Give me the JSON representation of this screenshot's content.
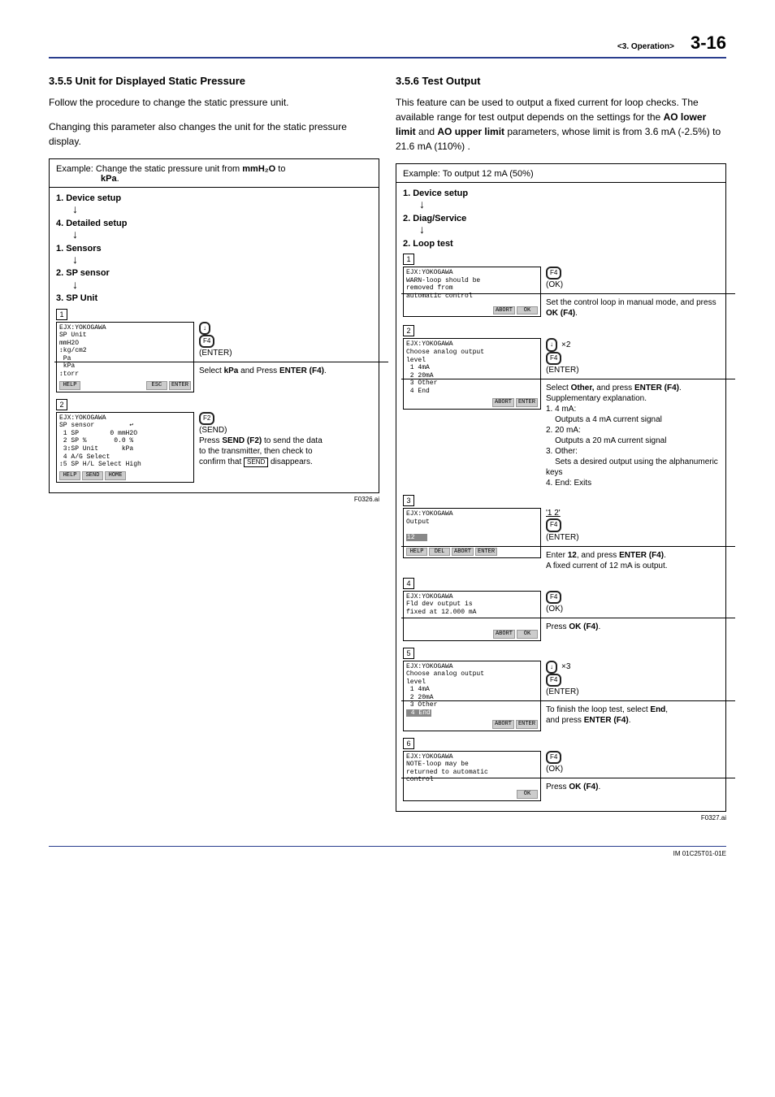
{
  "header": {
    "chapter": "<3. Operation>",
    "page": "3-16"
  },
  "left": {
    "heading": "3.5.5   Unit for Displayed Static Pressure",
    "para1": "Follow the procedure to change the static pressure unit.",
    "para2": "Changing this parameter also changes the unit for the static pressure display.",
    "example_prefix": "Example:  Change the static pressure unit from ",
    "example_strong1": "mmH₂O",
    "example_mid": " to ",
    "example_strong2": "kPa",
    "example_suffix": ".",
    "menu": [
      "1. Device setup",
      "4. Detailed setup",
      "1. Sensors",
      "2. SP sensor",
      "3. SP Unit"
    ],
    "step1_key1": "↓",
    "step1_key2": "F4",
    "step1_enter": "(ENTER)",
    "step1_text_a": "Select ",
    "step1_text_b": "kPa",
    "step1_text_c": " and Press ",
    "step1_text_d": "ENTER (F4)",
    "step1_text_e": ".",
    "step2_key1": "F2",
    "step2_send": "(SEND)",
    "step2_line1_a": "Press ",
    "step2_line1_b": "SEND (F2)",
    "step2_line1_c": " to send the data",
    "step2_line2": "to the transmitter, then check to",
    "step2_line3_a": "confirm that ",
    "step2_line3_tag": "SEND",
    "step2_line3_b": " disappears.",
    "lcd1": {
      "title": "EJX:YOKOGAWA",
      "lines": "SP Unit\nmmH2O\n↕kg/cm2\n Pa\n kPa\n↕torr",
      "sk1": "HELP",
      "sk2": "ESC",
      "sk3": "ENTER"
    },
    "lcd2": {
      "title": "EJX:YOKOGAWA",
      "lines": "SP sensor         ↩\n 1 SP        0 mmH2O\n 2 SP %       0.0 %\n 3↕SP Unit      kPa\n 4 A/G Select\n↕5 SP H/L Select High",
      "sk1": "HELP",
      "sk2": "SEND",
      "sk3": "HOME"
    },
    "figref": "F0326.ai"
  },
  "right": {
    "heading": "3.5.6   Test Output",
    "para_a": "This feature can be used to output a fixed current for loop checks. The available range for test output depends on the settings for the ",
    "para_b": "AO lower limit",
    "para_c": " and ",
    "para_d": "AO upper limit",
    "para_e": " parameters, whose limit is from 3.6 mA (-2.5%) to 21.6 mA (110%) .",
    "example": "Example:  To output 12 mA (50%)",
    "menu": [
      "1. Device setup",
      "2. Diag/Service",
      "2. Loop test"
    ],
    "s1_key": "F4",
    "s1_ok": "(OK)",
    "s1_text_a": "Set the control loop in manual mode, and press ",
    "s1_text_b": "OK (F4)",
    "s1_text_c": ".",
    "lcd1": {
      "title": "EJX:YOKOGAWA",
      "lines": "WARN-loop should be\nremoved from\nautomatic control",
      "sk1": "ABORT",
      "sk2": "OK"
    },
    "s2_arrow": "↓",
    "s2_x2": "×2",
    "s2_f4": "F4",
    "s2_enter": "(ENTER)",
    "s2_line1_a": "Select ",
    "s2_line1_b": "Other,",
    "s2_line1_c": " and press ",
    "s2_line1_d": "ENTER (F4)",
    "s2_line1_e": ".",
    "s2_supp": "Supplementary explanation.",
    "s2_li1": "1.  4 mA:",
    "s2_li1b": "Outputs a 4 mA current signal",
    "s2_li2": "2.  20 mA:",
    "s2_li2b": "Outputs a 20 mA current signal",
    "s2_li3": "3.  Other:",
    "s2_li3b": "Sets a desired output using the alphanumeric keys",
    "s2_li4": "4.  End: Exits",
    "lcd2": {
      "title": "EJX:YOKOGAWA",
      "lines": "Choose analog output\nlevel\n 1 4mA\n 2 20mA\n 3 Other\n 4 End",
      "sk1": "ABORT",
      "sk2": "ENTER"
    },
    "s3_char": "'1 2'",
    "s3_f4": "F4",
    "s3_enter": "(ENTER)",
    "s3_text_a": "Enter ",
    "s3_text_b": "12",
    "s3_text_c": ", and press ",
    "s3_text_d": "ENTER (F4)",
    "s3_text_e": ".",
    "s3_text2": "A fixed current of 12 mA is output.",
    "lcd3": {
      "title": "EJX:YOKOGAWA",
      "lines": "Output\n\n12",
      "sk1": "HELP",
      "sk2": "DEL",
      "sk3": "ABORT",
      "sk4": "ENTER"
    },
    "s4_f4": "F4",
    "s4_ok": "(OK)",
    "s4_text_a": "Press ",
    "s4_text_b": "OK (F4)",
    "s4_text_c": ".",
    "lcd4": {
      "title": "EJX:YOKOGAWA",
      "lines": "Fld dev output is\nfixed at 12.000 mA",
      "sk1": "ABORT",
      "sk2": "OK"
    },
    "s5_arrow": "↓",
    "s5_x3": "×3",
    "s5_f4": "F4",
    "s5_enter": "(ENTER)",
    "s5_text_a": "To finish the loop test, select ",
    "s5_text_b": "End",
    "s5_text_c": ",",
    "s5_text2_a": "and press ",
    "s5_text2_b": "ENTER (F4)",
    "s5_text2_c": ".",
    "lcd5": {
      "title": "EJX:YOKOGAWA",
      "lines": "Choose analog output\nlevel\n 1 4mA\n 2 20mA\n 3 Other\n 4 End",
      "hl": "4 End",
      "sk1": "ABORT",
      "sk2": "ENTER"
    },
    "s6_f4": "F4",
    "s6_ok": "(OK)",
    "s6_text_a": "Press ",
    "s6_text_b": "OK (F4)",
    "s6_text_c": ".",
    "lcd6": {
      "title": "EJX:YOKOGAWA",
      "lines": "NOTE-loop may be\nreturned to automatic\ncontrol",
      "sk1": "OK"
    },
    "figref": "F0327.ai"
  },
  "footer": {
    "doc": "IM 01C25T01-01E"
  }
}
